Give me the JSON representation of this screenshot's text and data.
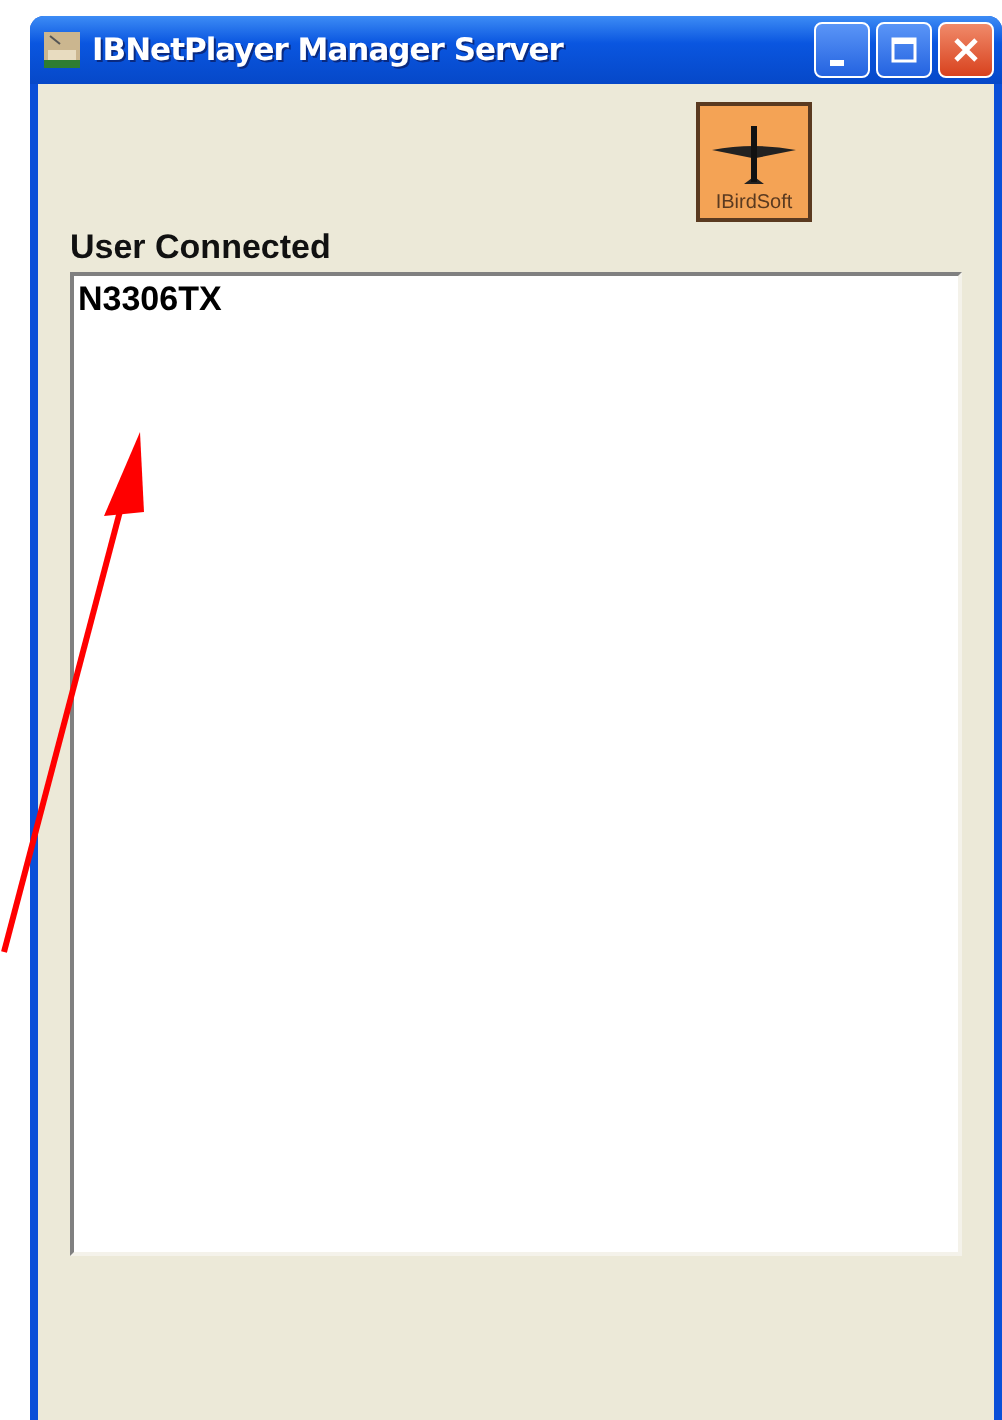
{
  "window": {
    "title": "IBNetPlayer Manager Server"
  },
  "logo": {
    "text": "IBirdSoft"
  },
  "user_list": {
    "label": "User Connected",
    "items": [
      "N3306TX"
    ]
  }
}
